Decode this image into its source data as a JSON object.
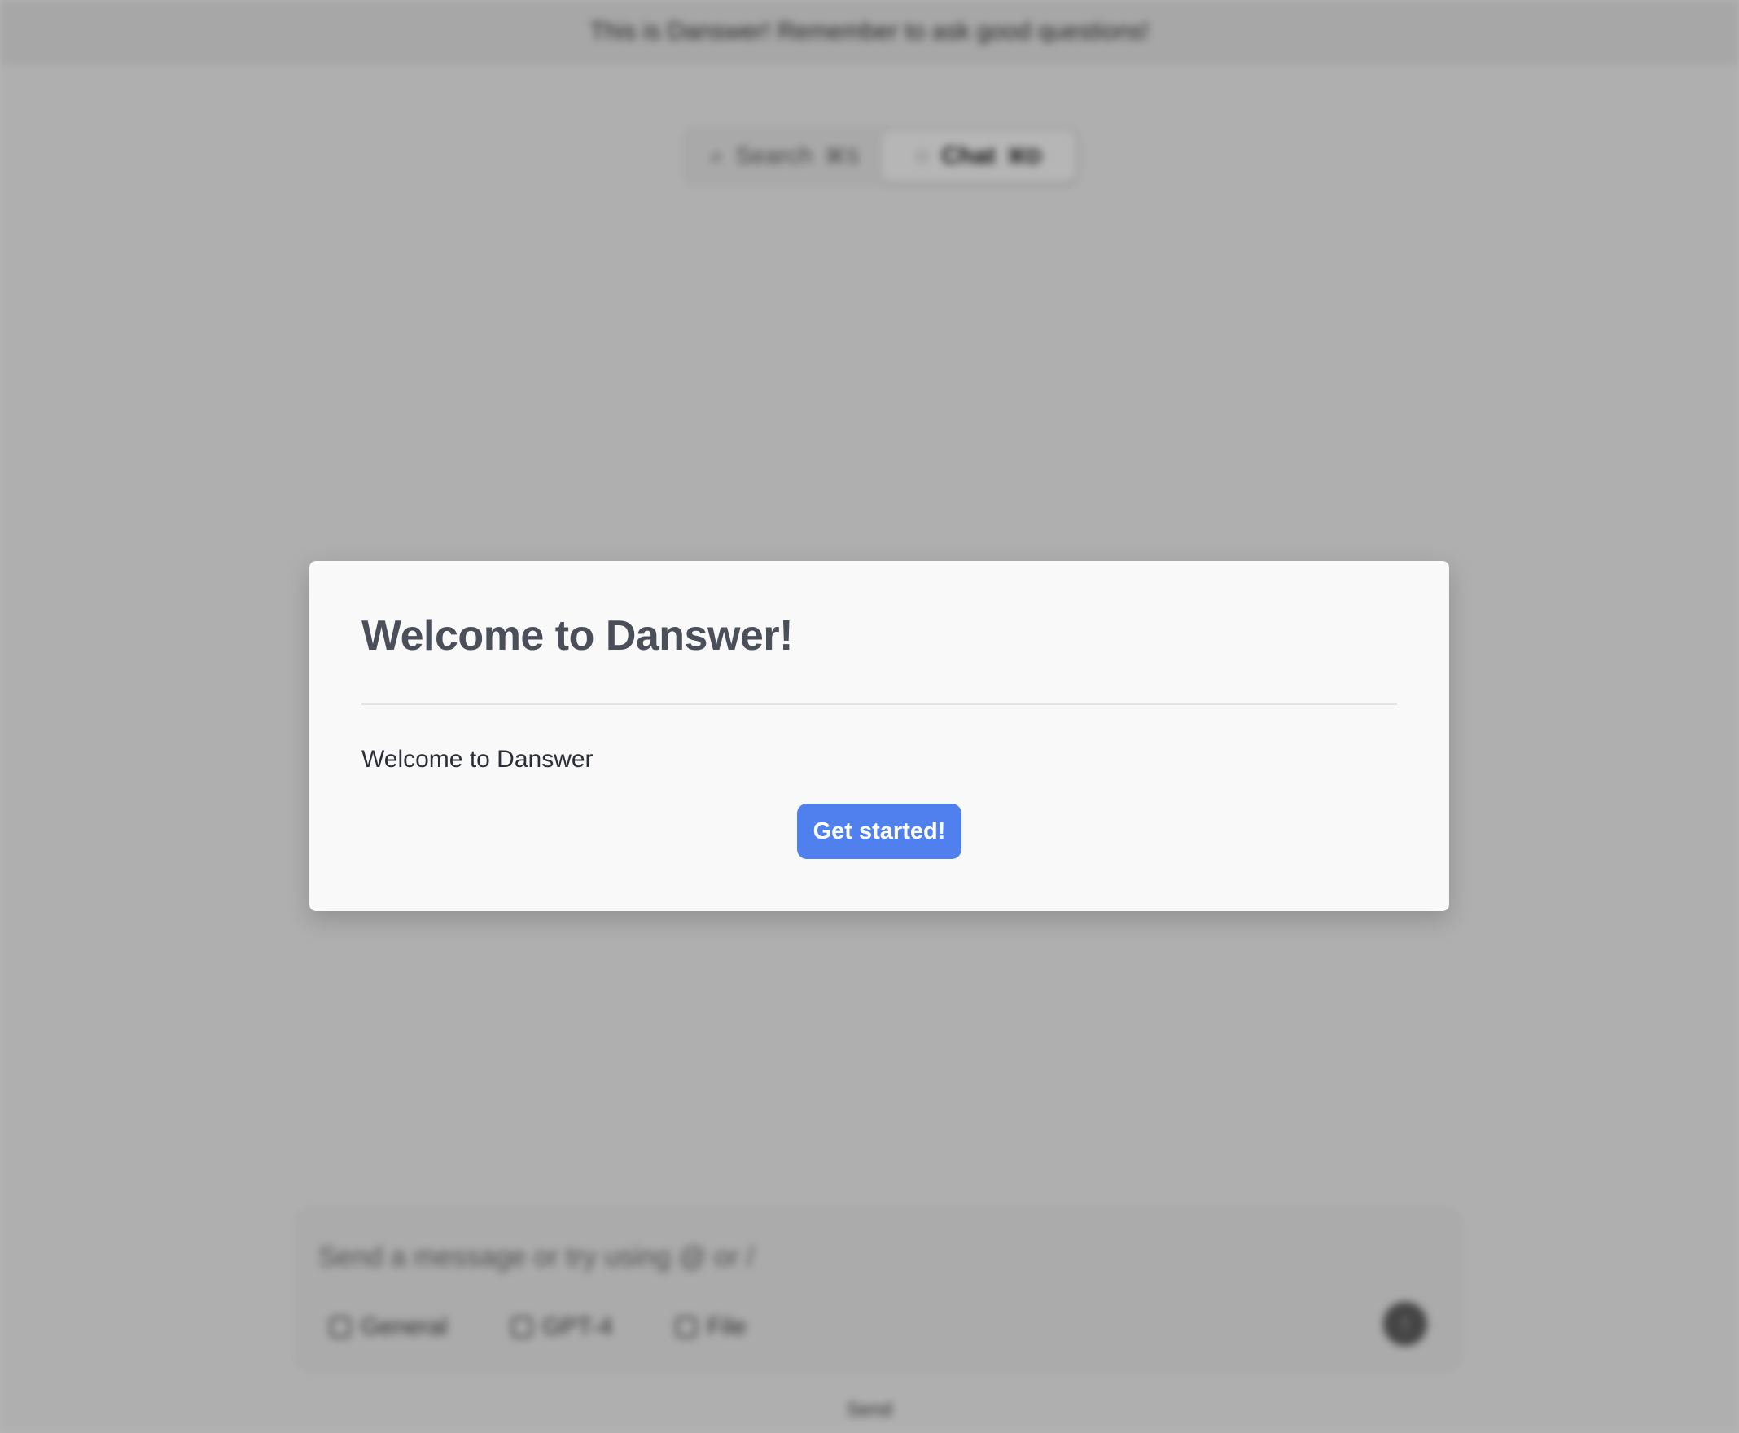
{
  "background": {
    "banner_text": "This is Danswer! Remember to ask good questions!",
    "mode_toggle": {
      "search": {
        "label": "Search",
        "shortcut": "⌘S",
        "icon": "search-icon"
      },
      "chat": {
        "label": "Chat",
        "shortcut": "⌘D",
        "icon": "chat-icon"
      }
    },
    "composer": {
      "placeholder": "Send a message or try using @ or /",
      "tools": [
        {
          "label": "General",
          "icon": "assistant-icon"
        },
        {
          "label": "GPT-4",
          "icon": "model-icon"
        },
        {
          "label": "File",
          "icon": "file-icon"
        }
      ],
      "send_icon": "arrow-up-icon"
    },
    "footer_text": "Send"
  },
  "modal": {
    "title": "Welcome to Danswer!",
    "body": "Welcome to Danswer",
    "button_label": "Get started!"
  },
  "colors": {
    "primary": "#4f80ee",
    "modal_bg": "#f9f9f9",
    "title": "#4a4f59"
  }
}
